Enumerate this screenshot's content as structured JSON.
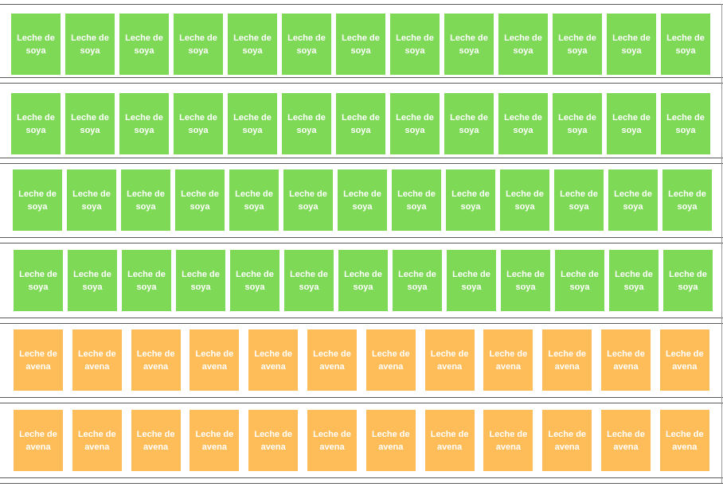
{
  "colors": {
    "soya": "#7ed957",
    "avena": "#ffbd59",
    "shelf_line": "#5a5a5a",
    "background": "#ffffff"
  },
  "shelves": [
    {
      "product": "soya",
      "items": [
        "Leche de soya",
        "Leche de soya",
        "Leche de soya",
        "Leche de soya",
        "Leche de soya",
        "Leche de soya",
        "Leche de soya",
        "Leche de soya",
        "Leche de soya",
        "Leche de soya",
        "Leche de soya",
        "Leche de soya",
        "Leche de soya"
      ]
    },
    {
      "product": "soya",
      "items": [
        "Leche de soya",
        "Leche de soya",
        "Leche de soya",
        "Leche de soya",
        "Leche de soya",
        "Leche de soya",
        "Leche de soya",
        "Leche de soya",
        "Leche de soya",
        "Leche de soya",
        "Leche de soya",
        "Leche de soya",
        "Leche de soya"
      ]
    },
    {
      "product": "soya",
      "items": [
        "Leche de soya",
        "Leche de soya",
        "Leche de soya",
        "Leche de soya",
        "Leche de soya",
        "Leche de soya",
        "Leche de soya",
        "Leche de soya",
        "Leche de soya",
        "Leche de soya",
        "Leche de soya",
        "Leche de soya",
        "Leche de soya"
      ]
    },
    {
      "product": "soya",
      "items": [
        "Leche de soya",
        "Leche de soya",
        "Leche de soya",
        "Leche de soya",
        "Leche de soya",
        "Leche de soya",
        "Leche de soya",
        "Leche de soya",
        "Leche de soya",
        "Leche de soya",
        "Leche de soya",
        "Leche de soya",
        "Leche de soya"
      ]
    },
    {
      "product": "avena",
      "items": [
        "Leche de avena",
        "Leche de avena",
        "Leche de avena",
        "Leche de avena",
        "Leche de avena",
        "Leche de avena",
        "Leche de avena",
        "Leche de avena",
        "Leche de avena",
        "Leche de avena",
        "Leche de avena",
        "Leche de avena"
      ]
    },
    {
      "product": "avena",
      "items": [
        "Leche de avena",
        "Leche de avena",
        "Leche de avena",
        "Leche de avena",
        "Leche de avena",
        "Leche de avena",
        "Leche de avena",
        "Leche de avena",
        "Leche de avena",
        "Leche de avena",
        "Leche de avena",
        "Leche de avena"
      ]
    }
  ]
}
